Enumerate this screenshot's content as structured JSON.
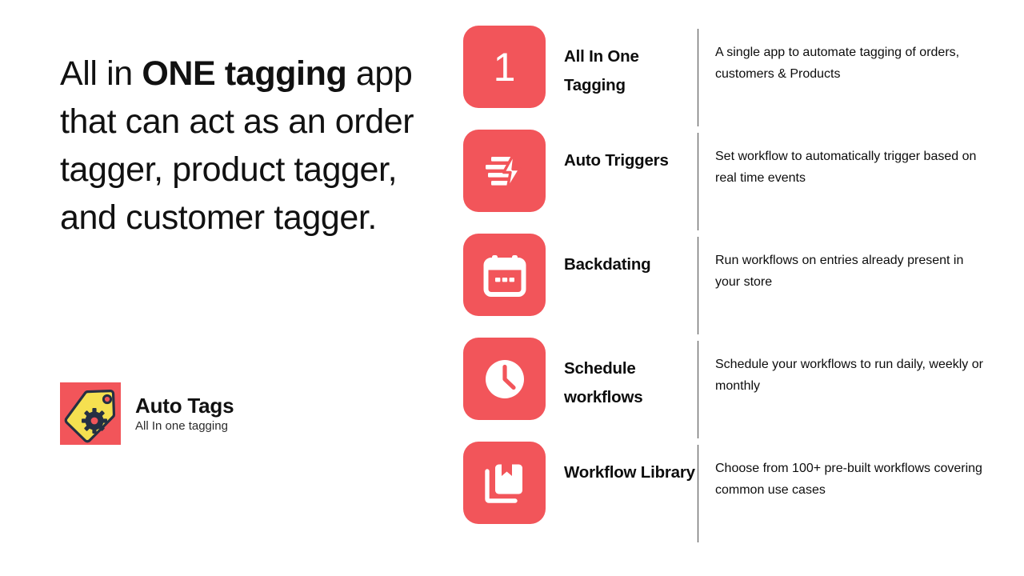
{
  "hero": {
    "headline_prefix": "All in ",
    "headline_strong": "ONE tagging",
    "headline_rest": " app that can act as an order tagger, product tagger, and customer tagger."
  },
  "brand": {
    "name": "Auto Tags",
    "tagline": "All In one tagging",
    "logo_icon": "price-tag-gear-icon",
    "tile_color": "#F2555A",
    "tag_color": "#F5E050",
    "gear_color": "#253043"
  },
  "theme": {
    "accent": "#F2555A",
    "text": "#0d0d0d",
    "divider": "#4a4a4a",
    "background": "#ffffff"
  },
  "features": [
    {
      "icon": "number-one-icon",
      "number": "1",
      "title": "All In One Tagging",
      "description": "A single app to automate tagging of orders, customers & Products"
    },
    {
      "icon": "lightning-lines-icon",
      "title": "Auto Triggers",
      "description": "Set workflow to automatically trigger based on real time events"
    },
    {
      "icon": "calendar-icon",
      "title": "Backdating",
      "description": "Run workflows on entries already present in your store"
    },
    {
      "icon": "clock-icon",
      "title": "Schedule workflows",
      "description": "Schedule your workflows to run daily, weekly or monthly"
    },
    {
      "icon": "book-library-icon",
      "title": "Workflow Library",
      "description": "Choose from 100+ pre-built workflows covering common use cases"
    }
  ]
}
